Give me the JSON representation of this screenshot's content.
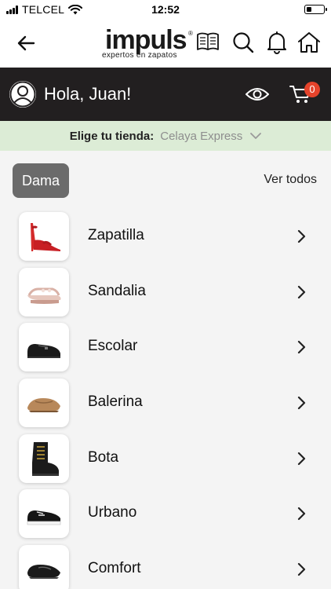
{
  "status_bar": {
    "carrier": "TELCEL",
    "time": "12:52"
  },
  "header": {
    "logo_word": "impuls",
    "logo_registered": "®",
    "logo_tagline": "expertos en zapatos",
    "icons": [
      "back-arrow-icon",
      "search-icon",
      "bell-icon",
      "home-icon"
    ]
  },
  "greeting": {
    "text": "Hola, Juan!",
    "cart_count": "0"
  },
  "store": {
    "label": "Elige tu tienda:",
    "value": "Celaya Express"
  },
  "category": {
    "chip": "Dama",
    "see_all": "Ver todos"
  },
  "items": [
    {
      "label": "Zapatilla",
      "icon": "red-heel-shoe-icon"
    },
    {
      "label": "Sandalia",
      "icon": "sandal-icon"
    },
    {
      "label": "Escolar",
      "icon": "school-shoe-icon"
    },
    {
      "label": "Balerina",
      "icon": "ballerina-flat-icon"
    },
    {
      "label": "Bota",
      "icon": "boot-icon"
    },
    {
      "label": "Urbano",
      "icon": "sneaker-icon"
    },
    {
      "label": "Comfort",
      "icon": "comfort-shoe-icon"
    }
  ],
  "colors": {
    "greeting_bg": "#221f20",
    "store_bg": "#dcecd6",
    "chip_bg": "#6b6b6b",
    "badge": "#e5432b",
    "page_bg": "#f4f4f4"
  }
}
